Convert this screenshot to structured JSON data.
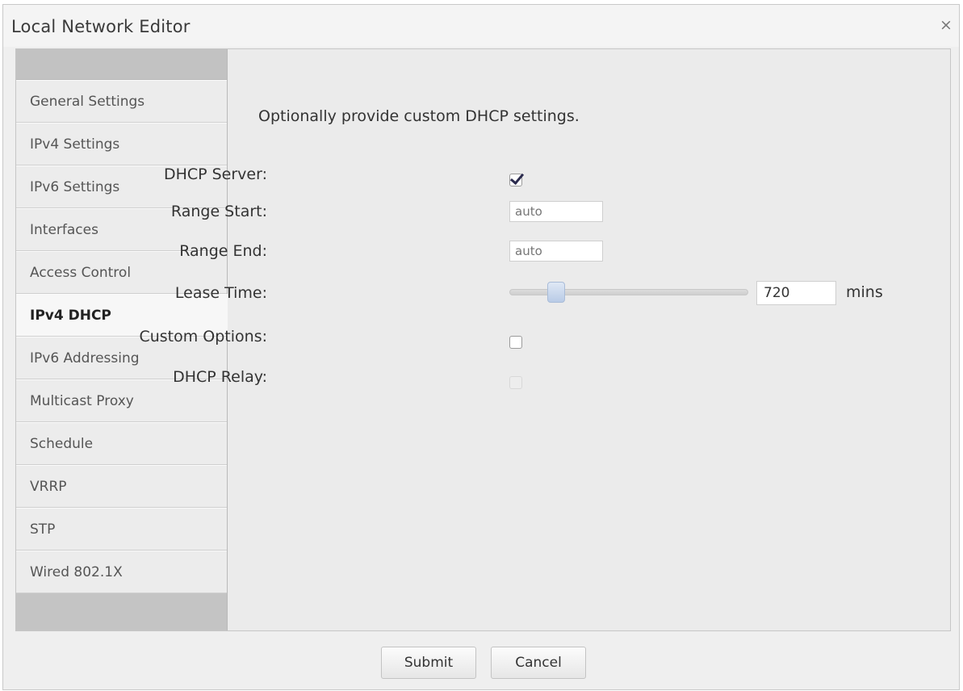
{
  "window": {
    "title": "Local Network Editor",
    "close_glyph": "×"
  },
  "sidebar": {
    "items": [
      {
        "label": "General Settings"
      },
      {
        "label": "IPv4 Settings"
      },
      {
        "label": "IPv6 Settings"
      },
      {
        "label": "Interfaces"
      },
      {
        "label": "Access Control"
      },
      {
        "label": "IPv4 DHCP",
        "active": true
      },
      {
        "label": "IPv6 Addressing"
      },
      {
        "label": "Multicast Proxy"
      },
      {
        "label": "Schedule"
      },
      {
        "label": "VRRP"
      },
      {
        "label": "STP"
      },
      {
        "label": "Wired 802.1X"
      }
    ]
  },
  "main": {
    "intro": "Optionally provide custom DHCP settings.",
    "dhcp_server": {
      "label": "DHCP Server:",
      "checked": true
    },
    "range_start": {
      "label": "Range Start:",
      "placeholder": "auto"
    },
    "range_end": {
      "label": "Range End:",
      "placeholder": "auto"
    },
    "lease_time": {
      "label": "Lease Time:",
      "value": "720",
      "unit": "mins",
      "slider_fraction": 0.17
    },
    "custom_options": {
      "label": "Custom Options:",
      "checked": false
    },
    "dhcp_relay": {
      "label": "DHCP Relay:",
      "checked": false,
      "disabled": true
    }
  },
  "footer": {
    "submit_label": "Submit",
    "cancel_label": "Cancel"
  }
}
